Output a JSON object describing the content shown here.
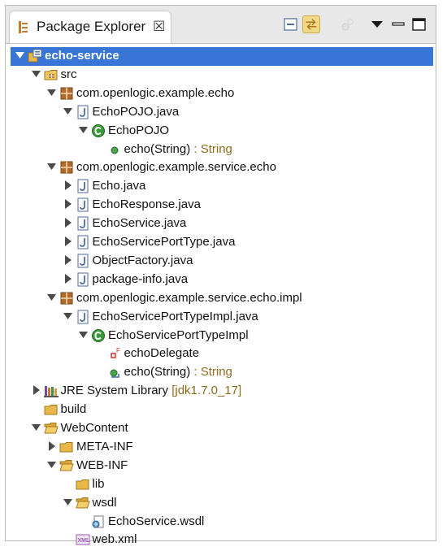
{
  "view": {
    "title": "Package Explorer",
    "close_glyph": "☒"
  },
  "toolbar": {
    "collapse_all": "collapse-all",
    "link_editor": "link-with-editor",
    "view_menu": "view-menu",
    "minimize": "minimize",
    "maximize": "maximize"
  },
  "tree": [
    {
      "label": "echo-service",
      "icon": "project",
      "depth": 0,
      "twisty": "open",
      "selected": true
    },
    {
      "label": "src",
      "icon": "source-folder",
      "depth": 1,
      "twisty": "open"
    },
    {
      "label": "com.openlogic.example.echo",
      "icon": "package",
      "depth": 2,
      "twisty": "open"
    },
    {
      "label": "EchoPOJO.java",
      "icon": "java-file",
      "depth": 3,
      "twisty": "open"
    },
    {
      "label": "EchoPOJO",
      "icon": "class",
      "depth": 4,
      "twisty": "open"
    },
    {
      "label": "echo(String)",
      "suffix": " : String",
      "icon": "public-method",
      "depth": 5,
      "twisty": "none"
    },
    {
      "label": "com.openlogic.example.service.echo",
      "icon": "package",
      "depth": 2,
      "twisty": "open"
    },
    {
      "label": "Echo.java",
      "icon": "java-file",
      "depth": 3,
      "twisty": "closed"
    },
    {
      "label": "EchoResponse.java",
      "icon": "java-file",
      "depth": 3,
      "twisty": "closed"
    },
    {
      "label": "EchoService.java",
      "icon": "java-file",
      "depth": 3,
      "twisty": "closed"
    },
    {
      "label": "EchoServicePortType.java",
      "icon": "java-file",
      "depth": 3,
      "twisty": "closed"
    },
    {
      "label": "ObjectFactory.java",
      "icon": "java-file",
      "depth": 3,
      "twisty": "closed"
    },
    {
      "label": "package-info.java",
      "icon": "java-file",
      "depth": 3,
      "twisty": "closed"
    },
    {
      "label": "com.openlogic.example.service.echo.impl",
      "icon": "package",
      "depth": 2,
      "twisty": "open"
    },
    {
      "label": "EchoServicePortTypeImpl.java",
      "icon": "java-file",
      "depth": 3,
      "twisty": "open"
    },
    {
      "label": "EchoServicePortTypeImpl",
      "icon": "class",
      "depth": 4,
      "twisty": "open"
    },
    {
      "label": "echoDelegate",
      "icon": "private-field",
      "depth": 5,
      "twisty": "none"
    },
    {
      "label": "echo(String)",
      "suffix": " : String",
      "icon": "override-method",
      "depth": 5,
      "twisty": "none"
    },
    {
      "label": "JRE System Library",
      "suffix": " [jdk1.7.0_17]",
      "icon": "library",
      "depth": 1,
      "twisty": "closed"
    },
    {
      "label": "build",
      "icon": "folder",
      "depth": 1,
      "twisty": "none"
    },
    {
      "label": "WebContent",
      "icon": "folder-open",
      "depth": 1,
      "twisty": "open"
    },
    {
      "label": "META-INF",
      "icon": "folder",
      "depth": 2,
      "twisty": "closed"
    },
    {
      "label": "WEB-INF",
      "icon": "folder-open",
      "depth": 2,
      "twisty": "open"
    },
    {
      "label": "lib",
      "icon": "folder",
      "depth": 3,
      "twisty": "none"
    },
    {
      "label": "wsdl",
      "icon": "folder-open",
      "depth": 3,
      "twisty": "open"
    },
    {
      "label": "EchoService.wsdl",
      "icon": "wsdl-file",
      "depth": 4,
      "twisty": "none"
    },
    {
      "label": "web.xml",
      "icon": "xml-file",
      "depth": 3,
      "twisty": "none"
    }
  ],
  "colors": {
    "selection": "#3875d7",
    "package": "#b06a2a",
    "folder": "#e8b84a",
    "class": "#3a9a3a",
    "suffix": "#8a6d1e"
  }
}
